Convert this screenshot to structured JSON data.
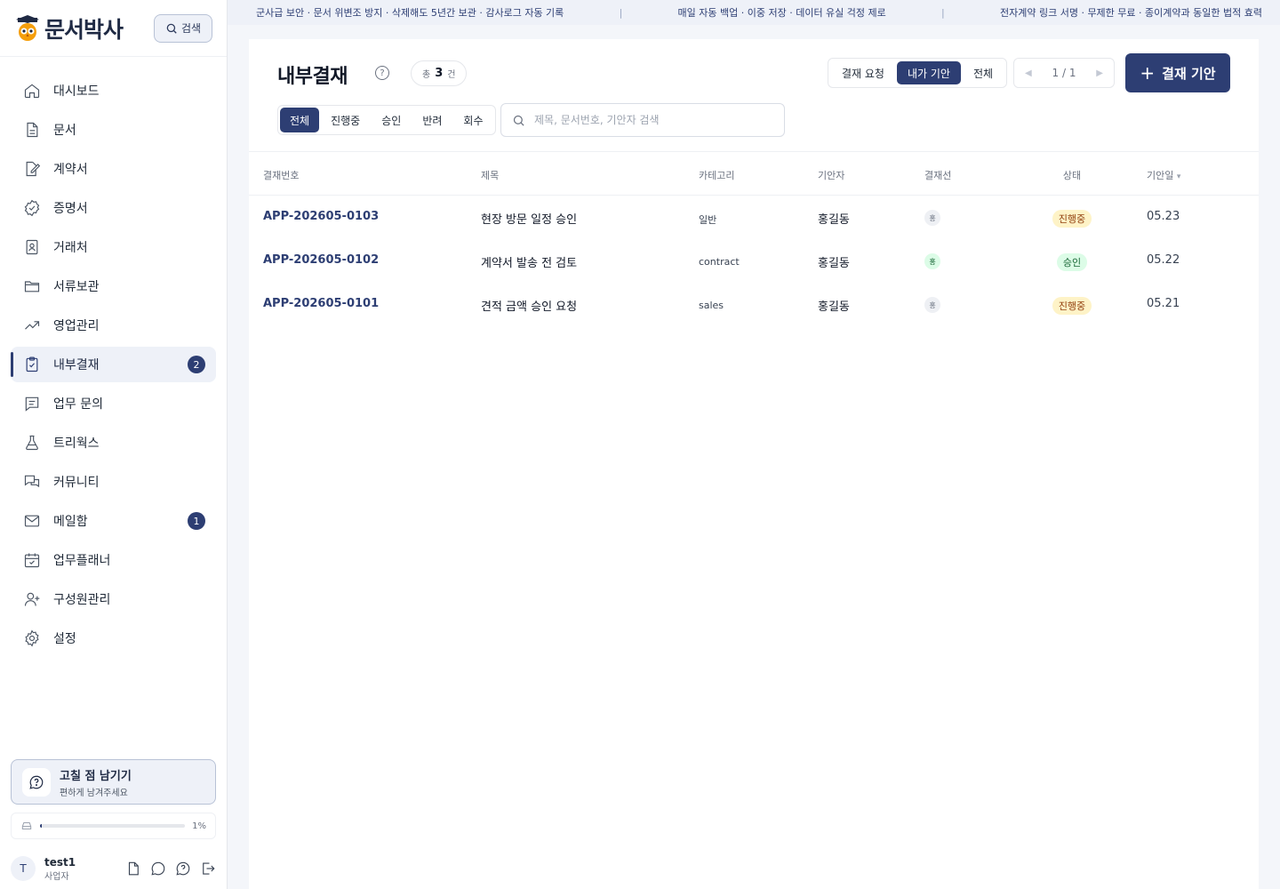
{
  "brand": {
    "name": "문서박사",
    "search_label": "검색"
  },
  "notice": {
    "items": [
      "군사급 보안 · 문서 위변조 방지 · 삭제해도 5년간 보관 · 감사로그 자동 기록",
      "매일 자동 백업 · 이중 저장 · 데이터 유실 걱정 제로",
      "전자계약 링크 서명 · 무제한 무료 · 종이계약과 동일한 법적 효력"
    ],
    "separator": "|"
  },
  "sidebar": {
    "items": [
      {
        "label": "대시보드",
        "icon": "home-icon"
      },
      {
        "label": "문서",
        "icon": "document-icon"
      },
      {
        "label": "계약서",
        "icon": "contract-icon"
      },
      {
        "label": "증명서",
        "icon": "certificate-icon"
      },
      {
        "label": "거래처",
        "icon": "contact-card-icon"
      },
      {
        "label": "서류보관",
        "icon": "folder-icon"
      },
      {
        "label": "영업관리",
        "icon": "trend-icon"
      },
      {
        "label": "내부결재",
        "icon": "clipboard-check-icon",
        "active": true,
        "badge": "2"
      },
      {
        "label": "업무 문의",
        "icon": "message-icon"
      },
      {
        "label": "트리웍스",
        "icon": "flask-icon"
      },
      {
        "label": "커뮤니티",
        "icon": "chat-icon"
      },
      {
        "label": "메일함",
        "icon": "mail-icon",
        "badge": "1"
      },
      {
        "label": "업무플래너",
        "icon": "calendar-icon"
      },
      {
        "label": "구성원관리",
        "icon": "user-plus-icon"
      },
      {
        "label": "설정",
        "icon": "gear-icon"
      }
    ],
    "feedback": {
      "title": "고칠 점 남기기",
      "subtitle": "편하게 남겨주세요"
    },
    "storage": {
      "percent_label": "1%",
      "fraction": 0.01
    },
    "user": {
      "initial": "T",
      "name": "test1",
      "role": "사업자"
    }
  },
  "main": {
    "title": "내부결재",
    "help": "?",
    "count": {
      "prefix": "총",
      "value": "3",
      "suffix": "건"
    },
    "scope_tabs": [
      {
        "label": "결재 요청"
      },
      {
        "label": "내가 기안",
        "active": true
      },
      {
        "label": "전체"
      }
    ],
    "pager": {
      "current": "1",
      "sep": "/",
      "total": "1"
    },
    "create_button": {
      "plus": "+",
      "label": "결재 기안"
    },
    "status_tabs": [
      {
        "label": "전체",
        "active": true
      },
      {
        "label": "진행중"
      },
      {
        "label": "승인"
      },
      {
        "label": "반려"
      },
      {
        "label": "회수"
      }
    ],
    "search": {
      "placeholder": "제목, 문서번호, 기안자 검색",
      "value": ""
    },
    "table": {
      "headers": {
        "no": "결재번호",
        "title": "제목",
        "category": "카테고리",
        "author": "기안자",
        "line": "결재선",
        "status": "상태",
        "date": "기안일"
      },
      "rows": [
        {
          "no": "APP-202605-0103",
          "title": "현장 방문 일정 승인",
          "category": "일반",
          "author": "홍길동",
          "line": "홍",
          "line_state": "pending",
          "status": "진행중",
          "status_kind": "pending",
          "date": "05.23"
        },
        {
          "no": "APP-202605-0102",
          "title": "계약서 발송 전 검토",
          "category": "contract",
          "author": "홍길동",
          "line": "홍",
          "line_state": "approved",
          "status": "승인",
          "status_kind": "approved",
          "date": "05.22"
        },
        {
          "no": "APP-202605-0101",
          "title": "견적 금액 승인 요청",
          "category": "sales",
          "author": "홍길동",
          "line": "홍",
          "line_state": "pending",
          "status": "진행중",
          "status_kind": "pending",
          "date": "05.21"
        }
      ]
    }
  },
  "colors": {
    "primary": "#2d3e73",
    "notice_bg": "#eef1f8",
    "pending_bg": "#fef3c7",
    "approved_bg": "#dcfce7"
  }
}
